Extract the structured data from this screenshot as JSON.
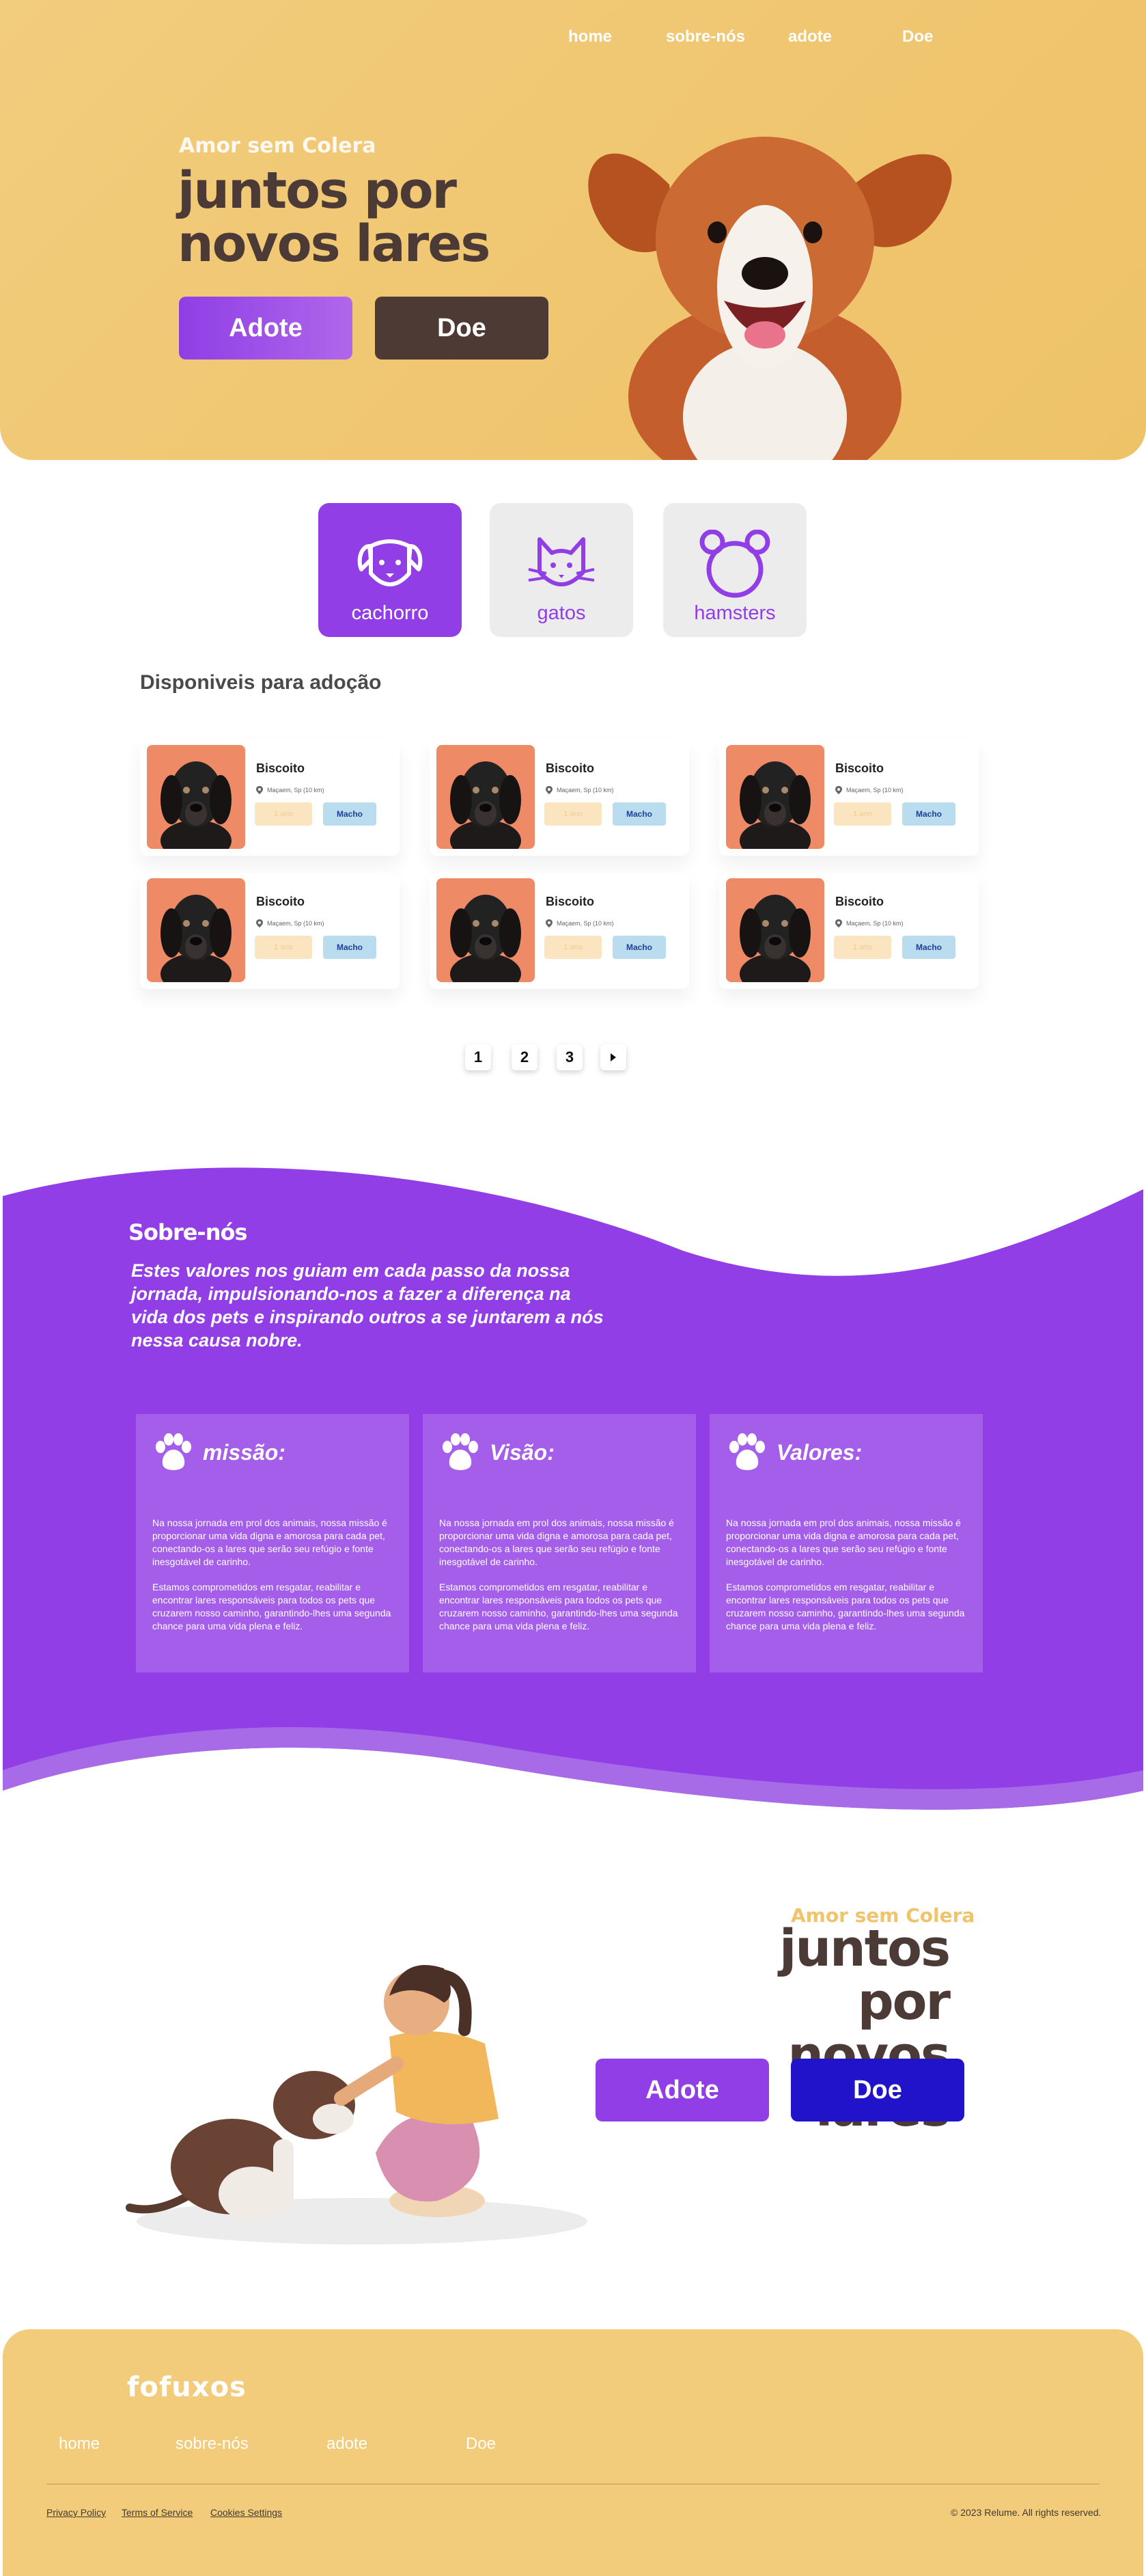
{
  "nav": {
    "items": [
      "home",
      "sobre-nós",
      "adote",
      "Doe"
    ]
  },
  "hero": {
    "kicker": "Amor sem Colera",
    "title_line1": "juntos por",
    "title_line2": "novos lares",
    "adote_label": "Adote",
    "doe_label": "Doe"
  },
  "categories": [
    {
      "label": "cachorro",
      "icon": "dog-icon",
      "active": true
    },
    {
      "label": "gatos",
      "icon": "cat-icon",
      "active": false
    },
    {
      "label": "hamsters",
      "icon": "hamster-icon",
      "active": false
    }
  ],
  "adoption": {
    "title": "Disponiveis para adoção",
    "pets": [
      {
        "name": "Biscoito",
        "location": "Maçaem, Sp (10 km)",
        "age": "1 ano",
        "sex": "Macho"
      },
      {
        "name": "Biscoito",
        "location": "Maçaem, Sp (10 km)",
        "age": "1 ano",
        "sex": "Macho"
      },
      {
        "name": "Biscoito",
        "location": "Maçaem, Sp (10 km)",
        "age": "1 ano",
        "sex": "Macho"
      },
      {
        "name": "Biscoito",
        "location": "Maçaem, Sp (10 km)",
        "age": "1 ano",
        "sex": "Macho"
      },
      {
        "name": "Biscoito",
        "location": "Maçaem, Sp (10 km)",
        "age": "1 ano",
        "sex": "Macho"
      },
      {
        "name": "Biscoito",
        "location": "Maçaem, Sp (10 km)",
        "age": "1 ano",
        "sex": "Macho"
      }
    ],
    "pagination": [
      "1",
      "2",
      "3"
    ]
  },
  "about": {
    "kicker": "Sobre-nós",
    "text": "Estes valores nos guiam em cada passo da nossa jornada, impulsionando-nos a fazer a diferença na vida dos pets e inspirando outros a se juntarem a nós nessa causa nobre.",
    "cards": [
      {
        "title": "missão:",
        "p1": "Na nossa jornada em prol dos animais, nossa missão é proporcionar uma vida digna e amorosa para cada pet, conectando-os a lares que serão seu refúgio e fonte inesgotável de carinho.",
        "p2": "Estamos comprometidos em resgatar, reabilitar e encontrar lares responsáveis para todos os pets que cruzarem nosso caminho, garantindo-lhes uma segunda chance para uma vida plena e feliz."
      },
      {
        "title": "Visão:",
        "p1": "Na nossa jornada em prol dos animais, nossa missão é proporcionar uma vida digna e amorosa para cada pet, conectando-os a lares que serão seu refúgio e fonte inesgotável de carinho.",
        "p2": "Estamos comprometidos em resgatar, reabilitar e encontrar lares responsáveis para todos os pets que cruzarem nosso caminho, garantindo-lhes uma segunda chance para uma vida plena e feliz."
      },
      {
        "title": "Valores:",
        "p1": "Na nossa jornada em prol dos animais, nossa missão é proporcionar uma vida digna e amorosa para cada pet, conectando-os a lares que serão seu refúgio e fonte inesgotável de carinho.",
        "p2": "Estamos comprometidos em resgatar, reabilitar e encontrar lares responsáveis para todos os pets que cruzarem nosso caminho, garantindo-lhes uma segunda chance para uma vida plena e feliz."
      }
    ]
  },
  "cta": {
    "kicker": "Amor sem Colera",
    "title_line1": "juntos por",
    "title_line2": "novos lares",
    "adote_label": "Adote",
    "doe_label": "Doe"
  },
  "footer": {
    "logo": "fofuxos",
    "nav": [
      "home",
      "sobre-nós",
      "adote",
      "Doe"
    ],
    "legal": [
      "Privacy Policy",
      "Terms of Service",
      "Cookies Settings"
    ],
    "copyright": "© 2023 Relume. All rights reserved."
  },
  "colors": {
    "purple": "#923ee6",
    "yellow": "#f2cc7a",
    "brown": "#4e3a34",
    "blue": "#2013c9"
  }
}
